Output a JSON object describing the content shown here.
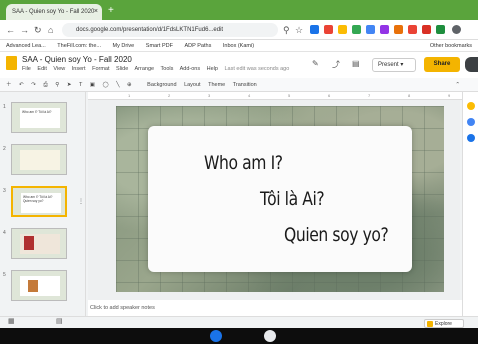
{
  "browser": {
    "tab_title": "SAA - Quien soy Yo - Fall 2020",
    "tab_close": "×",
    "new_tab": "+",
    "url": "docs.google.com/presentation/d/1FdsLKTN1Fud6...edit",
    "bookmarks": [
      "Advanced Lea...",
      "TheFill.com: the...",
      "My Drive",
      "Smart PDF",
      "ADP Paths",
      "Inbox (Kami)",
      "Other bookmarks"
    ]
  },
  "slides_app": {
    "doc_title": "SAA - Quien soy Yo - Fall 2020",
    "menus": [
      "File",
      "Edit",
      "View",
      "Insert",
      "Format",
      "Slide",
      "Arrange",
      "Tools",
      "Add-ons",
      "Help",
      "Last edit was seconds ago"
    ],
    "present_label": "Present",
    "share_label": "Share",
    "toolbar": [
      "Background",
      "Layout",
      "Theme",
      "Transition"
    ],
    "ruler_ticks": [
      "1",
      "2",
      "3",
      "4",
      "5",
      "6",
      "7",
      "8",
      "9"
    ]
  },
  "filmstrip": [
    {
      "num": "1",
      "text": "Who am I? Tôi là Ai?",
      "selected": false
    },
    {
      "num": "2",
      "text": "",
      "selected": false
    },
    {
      "num": "3",
      "text": "Who am I? Tôi là Ai? Quien soy yo?",
      "selected": true
    },
    {
      "num": "4",
      "text": "",
      "selected": false
    },
    {
      "num": "5",
      "text": "",
      "selected": false
    }
  ],
  "slide": {
    "line1": "Who am I?",
    "line2": "Tôi là Ai?",
    "line3": "Quien soy yo?"
  },
  "notes_placeholder": "Click to add speaker notes",
  "explore_label": "Explore",
  "colors": {
    "chrome_green": "#5aa43c",
    "slides_yellow": "#f4b400"
  }
}
